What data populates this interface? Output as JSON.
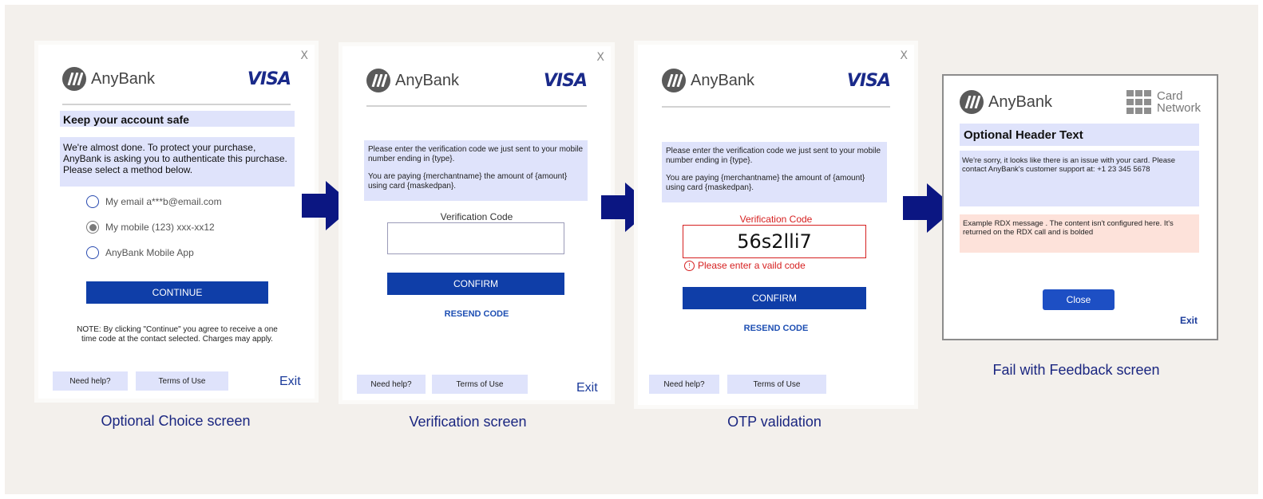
{
  "brand": {
    "bank_name": "AnyBank",
    "visa": "VISA",
    "card_network_line1": "Card",
    "card_network_line2": "Network"
  },
  "colors": {
    "primary_button": "#0f3ea8",
    "info_box": "#dfe3fb",
    "error": "#d62020",
    "caption": "#1a2680",
    "arrow": "#0b1682",
    "rdx_box": "#fde2da"
  },
  "screen1": {
    "close": "X",
    "header": "Keep your account safe",
    "intro": "We're almost done. To protect your purchase, AnyBank is asking you to authenticate this purchase. Please select a method below.",
    "options": [
      {
        "label": "My email a***b@email.com",
        "selected": false
      },
      {
        "label": "My mobile (123) xxx-xx12",
        "selected": true
      },
      {
        "label": "AnyBank Mobile App",
        "selected": false
      }
    ],
    "continue": "CONTINUE",
    "note": "NOTE: By clicking \"Continue\" you agree to receive a one time code at the contact selected. Charges may apply.",
    "help": "Need help?",
    "terms": "Terms of Use",
    "exit": "Exit",
    "caption": "Optional Choice screen"
  },
  "screen2": {
    "close": "X",
    "info_line1": "Please enter the verification code we just sent to your mobile number ending in {type}.",
    "info_line2": "You are paying {merchantname} the amount of {amount} using card {maskedpan}.",
    "code_label": "Verification Code",
    "code_value": "",
    "confirm": "CONFIRM",
    "resend": "RESEND CODE",
    "help": "Need help?",
    "terms": "Terms of Use",
    "exit": "Exit",
    "caption": "Verification screen"
  },
  "screen3": {
    "close": "X",
    "info_line1": "Please enter the verification code we just sent to your mobile number ending in {type}.",
    "info_line2": "You are paying {merchantname} the amount of {amount} using card {maskedpan}.",
    "code_label": "Verification Code",
    "code_value": "56s2lli7",
    "error_icon": "!",
    "error": "Please enter a vaild code",
    "confirm": "CONFIRM",
    "resend": "RESEND CODE",
    "help": "Need help?",
    "terms": "Terms of Use",
    "caption": "OTP validation"
  },
  "screen4": {
    "header": "Optional Header Text",
    "message": "We're sorry, it looks like there is an issue with your card. Please contact AnyBank's customer support at: +1 23 345 5678",
    "rdx": "Example RDX message . The content isn't configured here. It's returned on the RDX call and is bolded",
    "close": "Close",
    "exit": "Exit",
    "caption": "Fail with Feedback screen"
  }
}
